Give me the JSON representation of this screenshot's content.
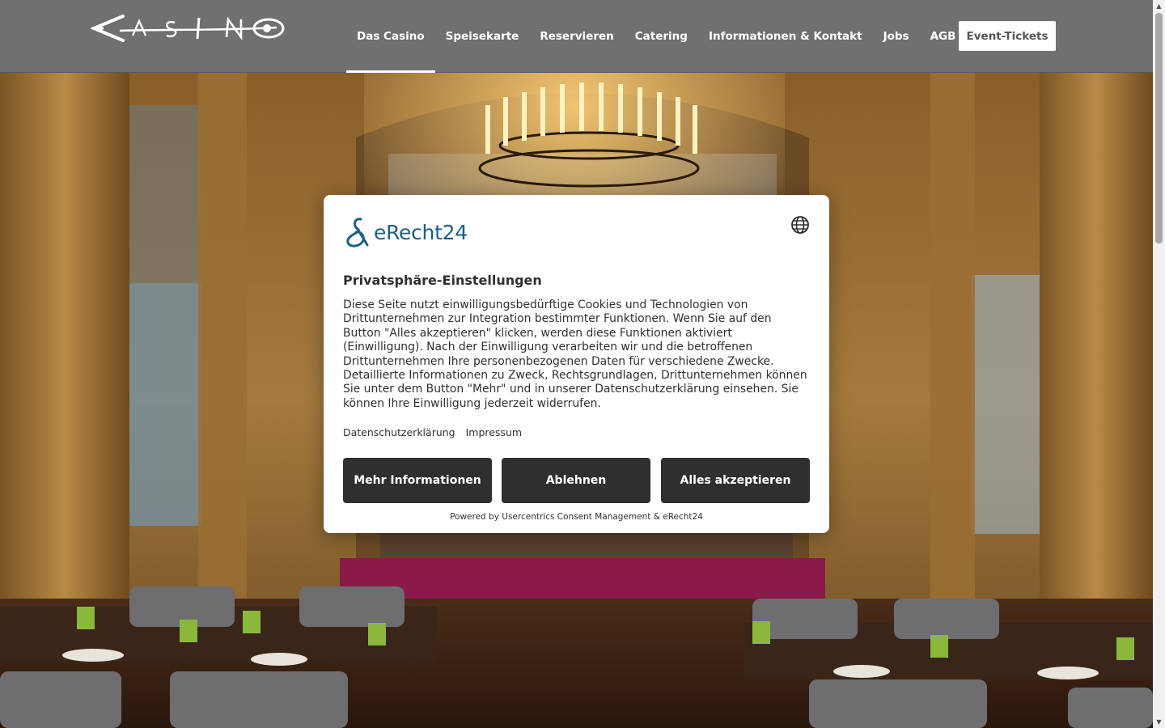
{
  "header": {
    "logo_alt": "Casino",
    "nav": [
      {
        "label": "Das Casino",
        "active": true
      },
      {
        "label": "Speisekarte"
      },
      {
        "label": "Reservieren"
      },
      {
        "label": "Catering"
      },
      {
        "label": "Informationen & Kontakt"
      },
      {
        "label": "Jobs"
      },
      {
        "label": "AGB"
      }
    ],
    "ticket_button": "Event-Tickets"
  },
  "hero": {
    "image_alt": "Restaurant interior with chandelier and set tables"
  },
  "consent": {
    "brand": "eRecht24",
    "title": "Privatsphäre-Einstellungen",
    "body": "Diese Seite nutzt einwilligungsbedürftige Cookies und Technologien von Drittunternehmen zur Integration bestimmter Funktionen. Wenn Sie auf den Button \"Alles akzeptieren\" klicken, werden diese Funktionen aktiviert (Einwilligung). Nach der Einwilligung verarbeiten wir und die betroffenen Drittunternehmen Ihre personenbezogenen Daten für verschiedene Zwecke. Detaillierte Informationen zu Zweck, Rechtsgrundlagen, Drittunternehmen können Sie unter dem Button \"Mehr\" und in unserer Datenschutzerklärung einsehen. Sie können Ihre Einwilligung jederzeit widerrufen.",
    "links": {
      "privacy": "Datenschutzerklärung",
      "imprint": "Impressum"
    },
    "buttons": {
      "more": "Mehr Informationen",
      "decline": "Ablehnen",
      "accept": "Alles akzeptieren"
    },
    "powered_by": "Powered by Usercentrics Consent Management & eRecht24"
  },
  "icons": {
    "globe": "globe-icon",
    "logo_mark": "erecht24-mark-icon"
  },
  "colors": {
    "header_bg": "#707070",
    "brand_blue": "#1d5f86",
    "button_dark": "#2d2f31"
  }
}
